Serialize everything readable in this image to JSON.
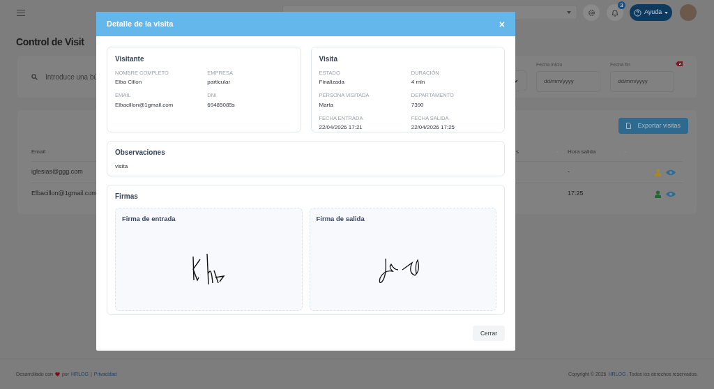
{
  "top_bar": {
    "notification_count": "3",
    "help_button": "Ayuda"
  },
  "page": {
    "title": "Control de Visit",
    "search": {
      "placeholder": "Introduce una bú"
    },
    "date_filters": [
      {
        "label": "Fecha inicio",
        "placeholder": "dd/mm/yyyy"
      },
      {
        "label": "Fecha fin",
        "placeholder": "dd/mm/yyyy"
      }
    ],
    "export_button": "Exportar visitas",
    "table": {
      "columns": [
        {
          "label": "Email"
        },
        {
          "label": "s"
        },
        {
          "label": "Hora salida"
        }
      ],
      "rows": [
        {
          "email": "iglesias@ggg.com",
          "exit_time": "-",
          "color": "#a8862a"
        },
        {
          "email": "Elbacillon@1gmail.com",
          "exit_time": "17:25",
          "color": "#1f6b33"
        }
      ]
    }
  },
  "modal": {
    "title": "Detalle de la visita",
    "close": "×",
    "sections": [
      {
        "title": "Visitante",
        "fields": [
          {
            "label": "NOMBRE COMPLETO",
            "value": "Elba Cillon"
          },
          {
            "label": "EMPRESA",
            "value": "particular"
          },
          {
            "label": "EMAIL",
            "value": "Elbacillon@1gmail.com"
          },
          {
            "label": "DNI",
            "value": "69485085s"
          }
        ]
      },
      {
        "title": "Visita",
        "fields": [
          {
            "label": "ESTADO",
            "value": "Finalizada"
          },
          {
            "label": "DURACIÓN",
            "value": "4 min"
          },
          {
            "label": "PERSONA VISITADA",
            "value": "Marta"
          },
          {
            "label": "DEPARTAMENTO",
            "value": "7390"
          },
          {
            "label": "FECHA ENTRADA",
            "value": "22/04/2026 17:21"
          },
          {
            "label": "FECHA SALIDA",
            "value": "22/04/2026 17:25"
          }
        ]
      }
    ],
    "observations": {
      "title": "Observaciones",
      "text": "visita"
    },
    "signatures": {
      "title": "Firmas",
      "items": [
        {
          "title": "Firma de entrada"
        },
        {
          "title": "Firma de salida"
        }
      ]
    },
    "close_button": "Cerrar"
  },
  "footer": {
    "left_text": "Desarrollado con",
    "by": "por",
    "brand_link": "HRLOG",
    "separator": "|",
    "privacy_link": "Privacidad",
    "copyright": "Copyright © 2026",
    "copyright_link": "HRLOG",
    "rights": ". Todos los derechos reservados."
  }
}
